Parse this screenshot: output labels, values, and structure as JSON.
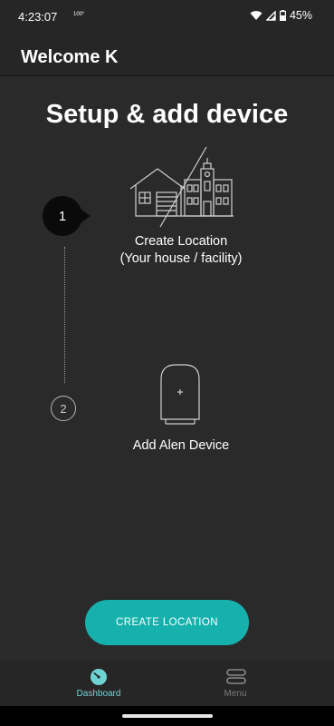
{
  "status_bar": {
    "time": "4:23:07",
    "small_text": "100°",
    "battery": "45%"
  },
  "header": {
    "title": "Welcome K"
  },
  "main": {
    "title": "Setup & add device",
    "steps": [
      {
        "number": "1",
        "label_line1": "Create Location",
        "label_line2": "(Your house / facility)",
        "active": true
      },
      {
        "number": "2",
        "label_line1": "Add Alen Device",
        "active": false
      }
    ],
    "cta_label": "CREATE LOCATION"
  },
  "bottom_nav": {
    "items": [
      {
        "label": "Dashboard",
        "icon": "dashboard-icon",
        "active": true
      },
      {
        "label": "Menu",
        "icon": "menu-icon",
        "active": false
      }
    ]
  },
  "colors": {
    "background": "#2a2a2a",
    "accent": "#16b1ac",
    "nav_active": "#6fd3d3",
    "nav_inactive": "#7a7a7a"
  }
}
